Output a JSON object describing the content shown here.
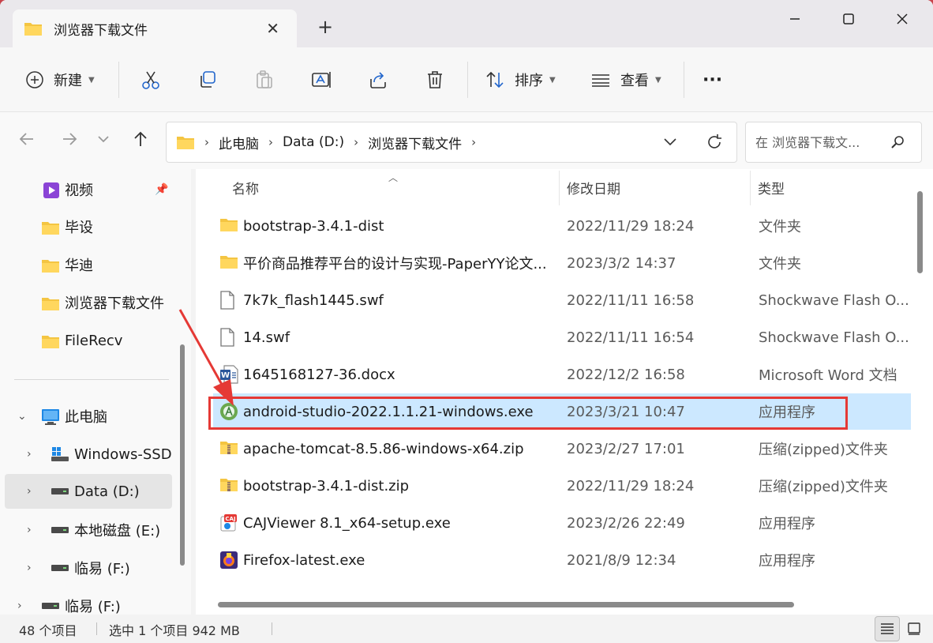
{
  "window": {
    "tab_title": "浏览器下载文件",
    "close_tab_glyph": "✕",
    "new_tab_glyph": "+"
  },
  "toolbar": {
    "new_label": "新建",
    "sort_label": "排序",
    "view_label": "查看",
    "more_glyph": "···"
  },
  "breadcrumb": [
    "此电脑",
    "Data (D:)",
    "浏览器下载文件"
  ],
  "search": {
    "placeholder": "在 浏览器下载文..."
  },
  "sidebar": {
    "quick_access": [
      {
        "label": "视频",
        "icon": "video-icon"
      },
      {
        "label": "毕设",
        "icon": "folder-icon"
      },
      {
        "label": "华迪",
        "icon": "folder-icon"
      },
      {
        "label": "浏览器下载文件",
        "icon": "folder-icon"
      },
      {
        "label": "FileRecv",
        "icon": "folder-icon"
      }
    ],
    "this_pc": "此电脑",
    "drives": [
      {
        "label": "Windows-SSD",
        "icon": "windows-drive-icon"
      },
      {
        "label": "Data (D:)",
        "icon": "drive-icon"
      },
      {
        "label": "本地磁盘 (E:)",
        "icon": "drive-icon"
      },
      {
        "label": "临易 (F:)",
        "icon": "drive-icon"
      }
    ],
    "extra": {
      "label": "临易 (F:)",
      "icon": "drive-icon"
    }
  },
  "columns": {
    "name": "名称",
    "date": "修改日期",
    "type": "类型"
  },
  "files": [
    {
      "name": "bootstrap-3.4.1-dist",
      "date": "2022/11/29 18:24",
      "type": "文件夹",
      "icon": "folder-icon"
    },
    {
      "name": "平价商品推荐平台的设计与实现-PaperYY论文...",
      "date": "2023/3/2 14:37",
      "type": "文件夹",
      "icon": "folder-icon"
    },
    {
      "name": "7k7k_flash1445.swf",
      "date": "2022/11/11 16:58",
      "type": "Shockwave Flash O...",
      "icon": "file-icon"
    },
    {
      "name": "14.swf",
      "date": "2022/11/11 16:54",
      "type": "Shockwave Flash O...",
      "icon": "file-icon"
    },
    {
      "name": "1645168127-36.docx",
      "date": "2022/12/2 16:58",
      "type": "Microsoft Word 文档",
      "icon": "word-icon"
    },
    {
      "name": "android-studio-2022.1.1.21-windows.exe",
      "date": "2023/3/21 10:47",
      "type": "应用程序",
      "icon": "android-studio-icon"
    },
    {
      "name": "apache-tomcat-8.5.86-windows-x64.zip",
      "date": "2023/2/27 17:01",
      "type": "压缩(zipped)文件夹",
      "icon": "zip-folder-icon"
    },
    {
      "name": "bootstrap-3.4.1-dist.zip",
      "date": "2022/11/29 18:24",
      "type": "压缩(zipped)文件夹",
      "icon": "zip-folder-icon"
    },
    {
      "name": "CAJViewer 8.1_x64-setup.exe",
      "date": "2023/2/26 22:49",
      "type": "应用程序",
      "icon": "cajviewer-icon"
    },
    {
      "name": "Firefox-latest.exe",
      "date": "2021/8/9 12:34",
      "type": "应用程序",
      "icon": "firefox-icon"
    }
  ],
  "selected_index": 5,
  "status": {
    "item_count": "48 个项目",
    "selection": "选中 1 个项目  942 MB"
  },
  "colors": {
    "selection": "#cce8ff",
    "highlight_box": "#e53935",
    "folder": "#f4c542"
  }
}
